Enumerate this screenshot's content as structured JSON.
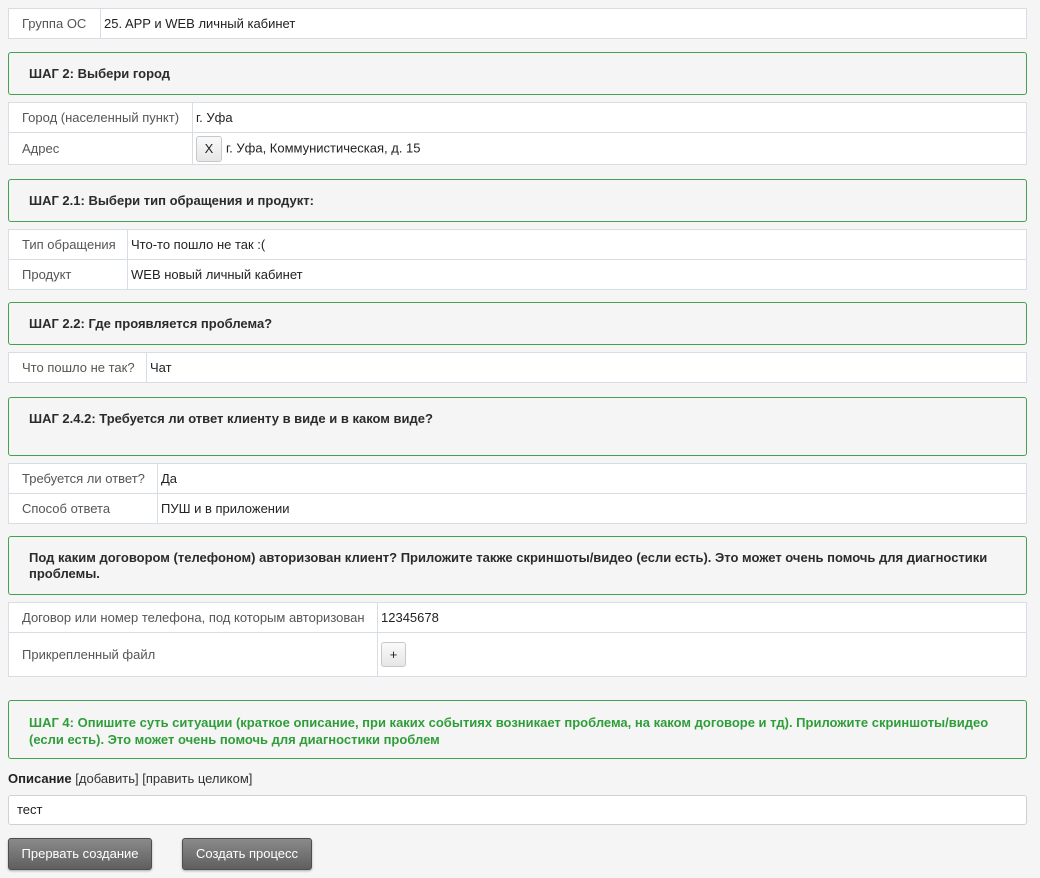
{
  "group": {
    "label": "Группа ОС",
    "value": "25. APP и WEB личный кабинет"
  },
  "step2": {
    "title": "ШАГ 2: Выбери город",
    "city_label": "Город (населенный пункт)",
    "city_value": "г. Уфа",
    "address_label": "Адрес",
    "address_clear": "X",
    "address_value": "г. Уфа, Коммунистическая, д. 15"
  },
  "step21": {
    "title": "ШАГ 2.1: Выбери тип обращения и продукт:",
    "type_label": "Тип обращения",
    "type_value": "Что-то пошло не так :(",
    "product_label": "Продукт",
    "product_value": "WEB новый личный кабинет"
  },
  "step22": {
    "title": "ШАГ 2.2: Где проявляется проблема?",
    "what_label": "Что пошло не так?",
    "what_value": "Чат"
  },
  "step242": {
    "title": "ШАГ 2.4.2: Требуется ли ответ клиенту в виде и в каком виде?",
    "answer_label": "Требуется ли ответ?",
    "answer_value": "Да",
    "method_label": "Способ ответа",
    "method_value": "ПУШ и в приложении"
  },
  "auth": {
    "title": "Под каким договором (телефоном) авторизован клиент? Приложите также скриншоты/видео (если есть). Это может очень помочь для диагностики проблемы.",
    "contract_label": "Договор или номер телефона, под которым авторизован",
    "contract_value": "12345678",
    "file_label": "Прикрепленный файл",
    "file_add": "+"
  },
  "step4": {
    "title": "ШАГ 4: Опишите суть ситуации (краткое описание, при каких событиях возникает проблема, на каком договоре и тд). Приложите скриншоты/видео (если есть). Это может очень помочь для диагностики проблем"
  },
  "description": {
    "label": "Описание",
    "add_link": "[добавить]",
    "edit_link": "[править целиком]",
    "value": "тест"
  },
  "buttons": {
    "abort": "Прервать создание",
    "create": "Создать процесс"
  },
  "colors": {
    "step_border": "#46a04f",
    "step4_text": "#2f9e3a",
    "button_bg": "#6e6e6e"
  }
}
